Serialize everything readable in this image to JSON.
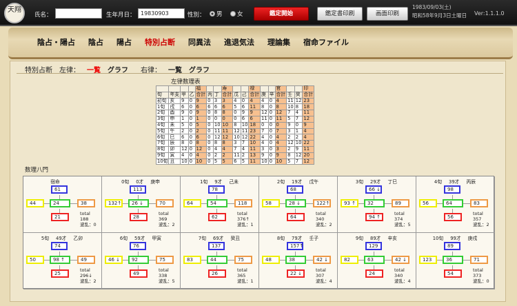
{
  "logo": {
    "text": "天翔"
  },
  "toolbar": {
    "name_label": "氏名：",
    "name_value": "",
    "birth_label": "生年月日：",
    "birth_value": "19830903",
    "sex_label": "性別：",
    "male": "男",
    "female": "女",
    "start_label": "鑑定開始",
    "cert_print_label": "鑑定書印刷",
    "screen_print_label": "画面印刷",
    "date1": "1983/09/03(土)",
    "date2": "昭和58年9月3日土曜日",
    "version": "Ver:1.1.1.0"
  },
  "nav": [
    "陰占・陽占",
    "陰占",
    "陽占",
    "特別占断",
    "同異法",
    "進退気法",
    "理論集",
    "宿命ファイル"
  ],
  "sub": {
    "title": "特別占断",
    "left_label": "左律：",
    "left_list": "一覧",
    "left_graph": "グラフ",
    "right_label": "右律：",
    "right_list": "一覧",
    "right_graph": "グラフ"
  },
  "table": {
    "title": "左律数理表",
    "group_headers": [
      "福",
      "寿",
      "禄",
      "官",
      "印"
    ],
    "sub_headers": [
      "旬",
      "年支",
      "甲",
      "乙",
      "合計",
      "丙",
      "丁",
      "合計",
      "戊",
      "己",
      "合計",
      "庚",
      "辛",
      "合計",
      "壬",
      "癸",
      "合計"
    ],
    "rows": [
      [
        "初旬",
        "亥",
        "9",
        "0",
        "9",
        "0",
        "3",
        "3",
        "4",
        "0",
        "4",
        "4",
        "0",
        "4",
        "11",
        "12",
        "23"
      ],
      [
        "1旬",
        "戌",
        "6",
        "0",
        "6",
        "6",
        "6",
        "6",
        "5",
        "6",
        "11",
        "8",
        "0",
        "8",
        "10",
        "8",
        "18"
      ],
      [
        "2旬",
        "酉",
        "9",
        "0",
        "9",
        "0",
        "8",
        "8",
        "0",
        "9",
        "9",
        "12",
        "0",
        "12",
        "7",
        "4",
        "11"
      ],
      [
        "3旬",
        "申",
        "1",
        "0",
        "1",
        "0",
        "0",
        "0",
        "0",
        "6",
        "6",
        "11",
        "0",
        "11",
        "5",
        "7",
        "12"
      ],
      [
        "4旬",
        "未",
        "5",
        "0",
        "5",
        "0",
        "10",
        "10",
        "8",
        "10",
        "18",
        "0",
        "0",
        "0",
        "9",
        "0",
        "9"
      ],
      [
        "5旬",
        "午",
        "2",
        "0",
        "2",
        "0",
        "11",
        "11",
        "12",
        "11",
        "23",
        "7",
        "0",
        "7",
        "3",
        "1",
        "4"
      ],
      [
        "6旬",
        "巳",
        "6",
        "0",
        "6",
        "0",
        "12",
        "12",
        "10",
        "12",
        "22",
        "4",
        "0",
        "4",
        "2",
        "2",
        "4"
      ],
      [
        "7旬",
        "辰",
        "8",
        "0",
        "8",
        "0",
        "8",
        "8",
        "3",
        "7",
        "10",
        "4",
        "0",
        "4",
        "12",
        "10",
        "22"
      ],
      [
        "8旬",
        "卯",
        "12",
        "0",
        "12",
        "0",
        "4",
        "4",
        "7",
        "4",
        "11",
        "3",
        "0",
        "3",
        "2",
        "9",
        "11"
      ],
      [
        "9旬",
        "寅",
        "4",
        "0",
        "4",
        "0",
        "2",
        "2",
        "11",
        "2",
        "13",
        "9",
        "0",
        "9",
        "8",
        "12",
        "20"
      ],
      [
        "10旬",
        "丑",
        "10",
        "0",
        "10",
        "0",
        "5",
        "5",
        "6",
        "5",
        "11",
        "10",
        "0",
        "10",
        "5",
        "7",
        "12"
      ]
    ]
  },
  "yamon": {
    "title": "数理八門",
    "cells": [
      {
        "h1": "宿命",
        "h2": "",
        "h3": "",
        "top": "61",
        "left": "44",
        "center": "24",
        "right": "38",
        "bottom": "21",
        "total_label": "total",
        "total": "188",
        "wave": "波乱：0"
      },
      {
        "h1": "0旬",
        "h2": "0才",
        "h3": "庚申",
        "top": "113",
        "left": "132↑",
        "center": "26 ↓",
        "right": "70",
        "bottom": "28",
        "total_label": "total",
        "total": "369",
        "wave": "波乱：2"
      },
      {
        "h1": "1旬",
        "h2": "9才",
        "h3": "己未",
        "top": "78",
        "left": "64",
        "center": "54",
        "right": "118",
        "bottom": "62",
        "total_label": "total",
        "total": "376↑",
        "wave": "波乱：1"
      },
      {
        "h1": "2旬",
        "h2": "19才",
        "h3": "戊午",
        "top": "68",
        "left": "58",
        "center": "28 ↓",
        "right": "122↑",
        "bottom": "64",
        "total_label": "total",
        "total": "340",
        "wave": "波乱：2"
      },
      {
        "h1": "3旬",
        "h2": "29才",
        "h3": "丁巳",
        "top": "66 ↓",
        "left": "93 ↑",
        "center": "32",
        "right": "89",
        "bottom": "94 ↑",
        "total_label": "total",
        "total": "374",
        "wave": "波乱：5"
      },
      {
        "h1": "4旬",
        "h2": "39才",
        "h3": "丙辰",
        "top": "98",
        "left": "56",
        "center": "64",
        "right": "83",
        "bottom": "56",
        "total_label": "total",
        "total": "357",
        "wave": "波乱：2"
      },
      {
        "h1": "5旬",
        "h2": "49才",
        "h3": "乙卯",
        "top": "74",
        "left": "50",
        "center": "98 ↑",
        "right": "49",
        "bottom": "25",
        "total_label": "total",
        "total": "296↓",
        "wave": "波乱：2"
      },
      {
        "h1": "6旬",
        "h2": "59才",
        "h3": "甲寅",
        "top": "76",
        "left": "46 ↓",
        "center": "92",
        "right": "75",
        "bottom": "49",
        "total_label": "total",
        "total": "338",
        "wave": "波乱：5"
      },
      {
        "h1": "7旬",
        "h2": "69才",
        "h3": "癸丑",
        "top": "137",
        "left": "83",
        "center": "44",
        "right": "75",
        "bottom": "26",
        "total_label": "total",
        "total": "365",
        "wave": "波乱：1"
      },
      {
        "h1": "8旬",
        "h2": "79才",
        "h3": "壬子",
        "top": "157↑",
        "left": "48",
        "center": "38",
        "right": "42 ↓",
        "bottom": "22 ↓",
        "total_label": "total",
        "total": "307",
        "wave": "波乱：4"
      },
      {
        "h1": "9旬",
        "h2": "89才",
        "h3": "辛亥",
        "top": "129",
        "left": "82",
        "center": "63",
        "right": "42 ↓",
        "bottom": "24",
        "total_label": "total",
        "total": "340",
        "wave": "波乱：4"
      },
      {
        "h1": "10旬",
        "h2": "99才",
        "h3": "庚戌",
        "top": "89",
        "left": "123",
        "center": "36",
        "right": "71",
        "bottom": "54",
        "total_label": "total",
        "total": "373",
        "wave": "波乱：0"
      }
    ]
  }
}
